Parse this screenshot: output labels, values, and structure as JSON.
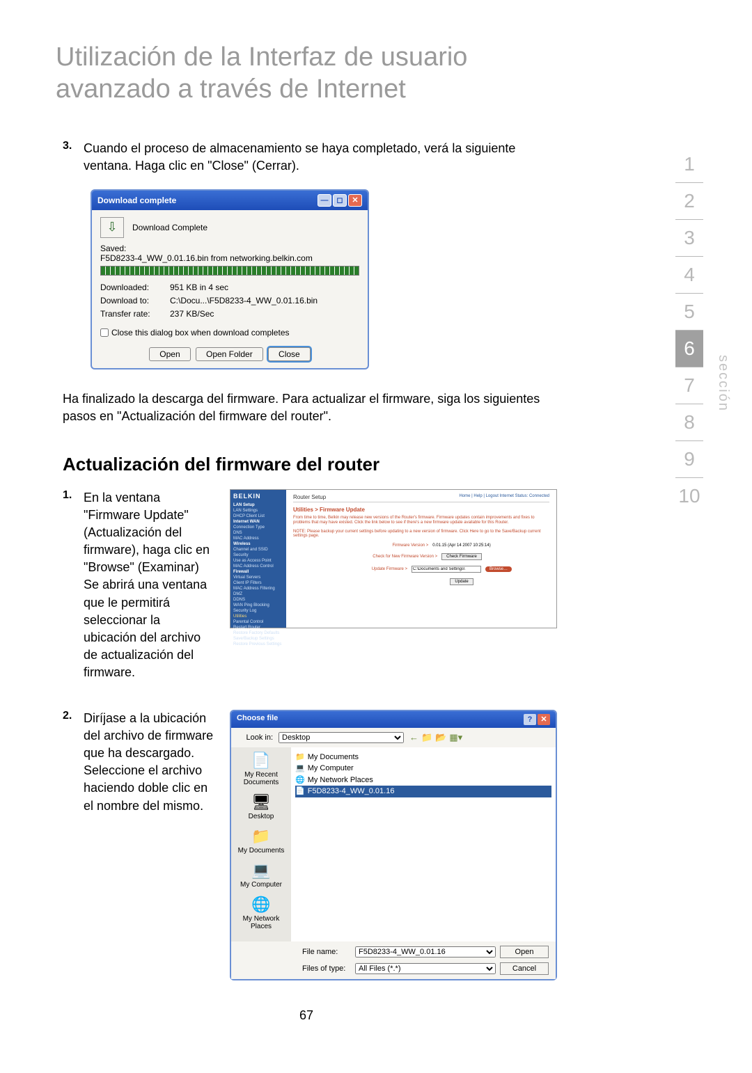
{
  "title": "Utilización de la Interfaz de usuario avanzado a través de Internet",
  "step3": {
    "num": "3.",
    "text": "Cuando el proceso de almacenamiento se haya completado, verá la siguiente ventana. Haga clic en \"Close\" (Cerrar)."
  },
  "dl": {
    "title": "Download complete",
    "complete": "Download Complete",
    "saved_label": "Saved:",
    "saved_file": "F5D8233-4_WW_0.01.16.bin from networking.belkin.com",
    "downloaded_label": "Downloaded:",
    "downloaded_val": "951 KB in 4 sec",
    "downloadto_label": "Download to:",
    "downloadto_val": "C:\\Docu...\\F5D8233-4_WW_0.01.16.bin",
    "rate_label": "Transfer rate:",
    "rate_val": "237 KB/Sec",
    "checkbox": "Close this dialog box when download completes",
    "open": "Open",
    "open_folder": "Open Folder",
    "close": "Close"
  },
  "para_after": "Ha finalizado la descarga del firmware. Para actualizar el firmware, siga los siguientes pasos en \"Actualización del firmware del router\".",
  "subheading": "Actualización del firmware del router",
  "step1": {
    "num": "1.",
    "text": "En la ventana \"Firmware Update\" (Actualización del firmware), haga clic en \"Browse\" (Examinar) Se abrirá una ventana que le permitirá seleccionar la ubicación del archivo de actualización del firmware."
  },
  "step2": {
    "num": "2.",
    "text": "Diríjase a la ubicación del archivo de firmware que ha descargado. Seleccione el archivo haciendo doble clic en el nombre del mismo."
  },
  "fw": {
    "logo": "BELKIN",
    "topbar": "Router Setup",
    "toplinks": "Home | Help | Logout    Internet Status: Connected",
    "heading": "Utilities > Firmware Update",
    "body": "From time to time, Belkin may release new versions of the Router's firmware. Firmware updates contain improvements and fixes to problems that may have existed. Click the link below to see if there's a new firmware update available for this Router.",
    "note": "NOTE: Please backup your current settings before updating to a new version of firmware. Click Here to go to the Save/Backup current settings page.",
    "fv_label": "Firmware Version >",
    "fv_val": "0.01.15 (Apr 14 2007 10:25:14)",
    "chk_label": "Check for New Firmware Version >",
    "chk_btn": "Check Firmware",
    "upd_label": "Update Firmware >",
    "upd_input": "C:\\Documents and Settings\\",
    "browse": "Browse…",
    "update": "Update",
    "sidebar_items": [
      "LAN Setup",
      "LAN Settings",
      "DHCP Client List",
      "Internet WAN",
      "Connection Type",
      "DNS",
      "MAC Address",
      "Wireless",
      "Channel and SSID",
      "Security",
      "Use as Access Point",
      "MAC Address Control",
      "Firewall",
      "Virtual Servers",
      "Client IP Filters",
      "MAC Address Filtering",
      "DMZ",
      "DDNS",
      "WAN Ping Blocking",
      "Security Log",
      "Utilities",
      "Parental Control",
      "Restart Router",
      "Restore Factory Defaults",
      "Save/Backup Settings",
      "Restore Previous Settings"
    ]
  },
  "chooser": {
    "title": "Choose file",
    "lookin": "Look in:",
    "lookin_val": "Desktop",
    "items": [
      "My Documents",
      "My Computer",
      "My Network Places",
      "F5D8233-4_WW_0.01.16"
    ],
    "places": [
      "My Recent Documents",
      "Desktop",
      "My Documents",
      "My Computer",
      "My Network Places"
    ],
    "filename_label": "File name:",
    "filename_val": "F5D8233-4_WW_0.01.16",
    "filetype_label": "Files of type:",
    "filetype_val": "All Files (*.*)",
    "open": "Open",
    "cancel": "Cancel"
  },
  "nav": {
    "items": [
      "1",
      "2",
      "3",
      "4",
      "5",
      "6",
      "7",
      "8",
      "9",
      "10"
    ],
    "active_index": 5,
    "label": "sección"
  },
  "page_num": "67"
}
